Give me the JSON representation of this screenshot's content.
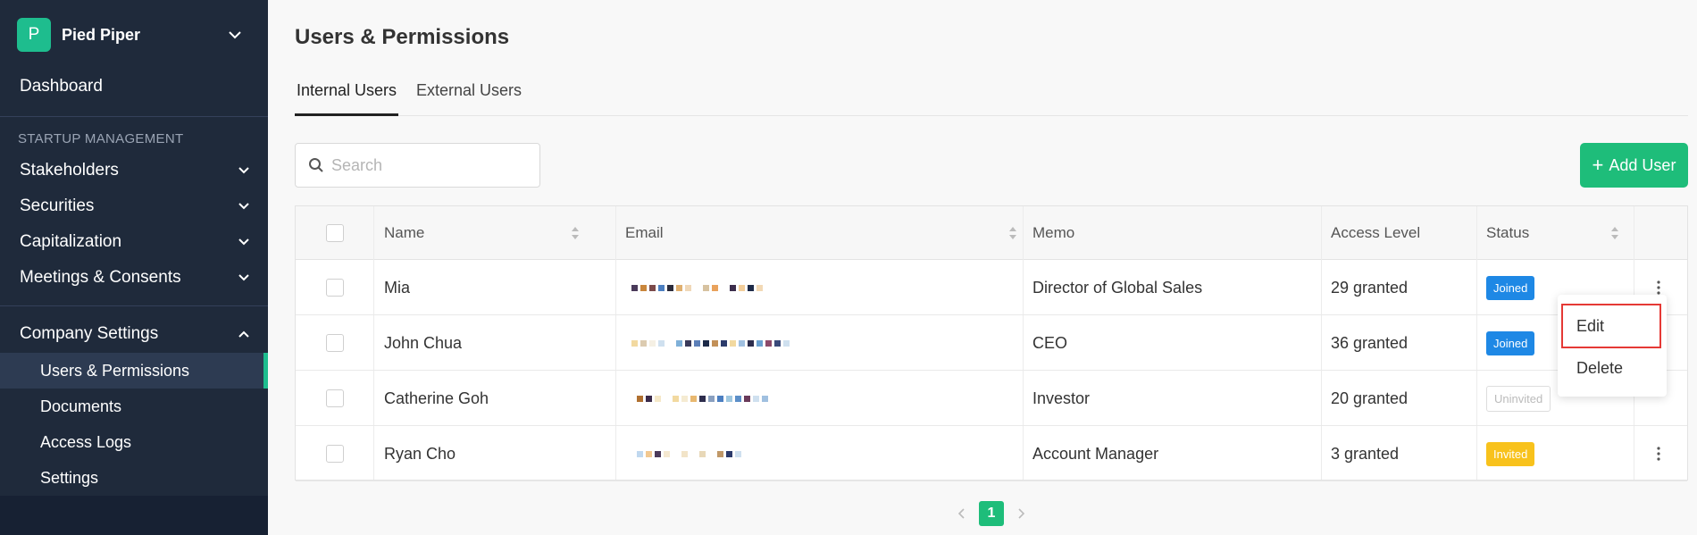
{
  "org": {
    "initial": "P",
    "name": "Pied Piper"
  },
  "sidebar": {
    "dashboard": "Dashboard",
    "section_label": "STARTUP MANAGEMENT",
    "items": [
      {
        "label": "Stakeholders"
      },
      {
        "label": "Securities"
      },
      {
        "label": "Capitalization"
      },
      {
        "label": "Meetings & Consents"
      }
    ],
    "company_settings": {
      "label": "Company Settings",
      "children": [
        {
          "label": "Users & Permissions",
          "active": true
        },
        {
          "label": "Documents"
        },
        {
          "label": "Access Logs"
        },
        {
          "label": "Settings"
        }
      ]
    }
  },
  "main": {
    "title": "Users & Permissions",
    "tabs": [
      {
        "label": "Internal Users",
        "active": true
      },
      {
        "label": "External Users"
      }
    ],
    "search": {
      "placeholder": "Search",
      "value": ""
    },
    "add_user_label": "Add User"
  },
  "table": {
    "headers": {
      "name": "Name",
      "email": "Email",
      "memo": "Memo",
      "access": "Access Level",
      "status": "Status"
    },
    "rows": [
      {
        "name": "Mia",
        "memo": "Director of Global Sales",
        "access": "29 granted",
        "status": "Joined"
      },
      {
        "name": "John Chua",
        "memo": "CEO",
        "access": "36 granted",
        "status": "Joined"
      },
      {
        "name": "Catherine Goh",
        "memo": "Investor",
        "access": "20 granted",
        "status": "Uninvited"
      },
      {
        "name": "Ryan Cho",
        "memo": "Account Manager",
        "access": "3 granted",
        "status": "Invited"
      }
    ]
  },
  "context_menu": {
    "items": [
      "Edit",
      "Delete"
    ]
  },
  "pagination": {
    "current": "1"
  },
  "colors": {
    "accent": "#1ebd7a",
    "sidebar_bg": "#1f2a3b",
    "joined": "#1e88e5",
    "invited": "#f8c21c",
    "highlight": "#e53935"
  }
}
